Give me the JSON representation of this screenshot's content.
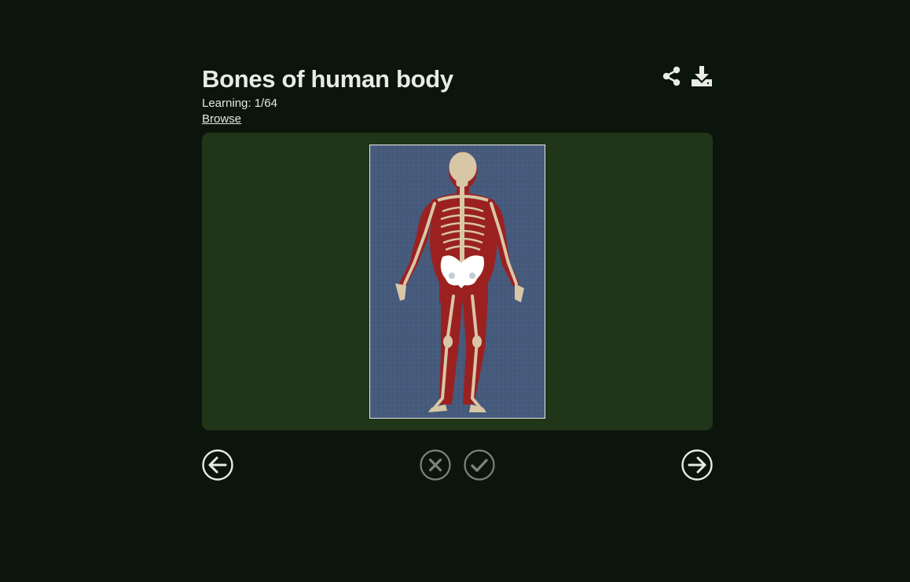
{
  "deck": {
    "title": "Bones of human body",
    "progress": "Learning: 1/64",
    "browse_label": "Browse"
  },
  "toolbar": {
    "share_icon": "share-icon",
    "download_icon": "download-icon"
  },
  "card": {
    "image_subject": "skeleton-figure"
  },
  "navigation": {
    "prev_icon": "arrow-left-circle-icon",
    "next_icon": "arrow-right-circle-icon",
    "wrong_icon": "x-circle-icon",
    "correct_icon": "check-circle-icon"
  },
  "colors": {
    "background": "#0c150b",
    "card": "#213518",
    "text": "#e4e8e2",
    "image_bg": "#465a7c",
    "muscle": "#9b2121",
    "bone": "#d8c7a6",
    "highlight_bone": "#ffffff"
  }
}
